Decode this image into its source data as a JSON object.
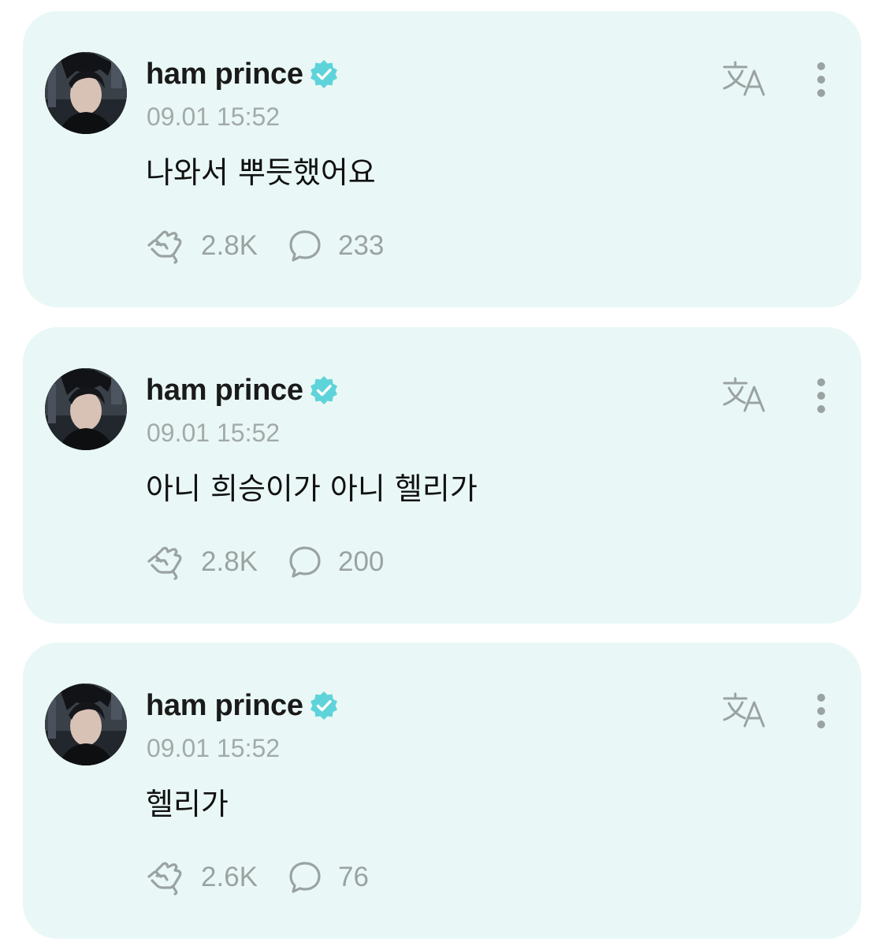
{
  "posts": [
    {
      "author": "ham prince",
      "time": "09.01 15:52",
      "text": "나와서 뿌듯했어요",
      "likes": "2.8K",
      "comments": "233"
    },
    {
      "author": "ham prince",
      "time": "09.01 15:52",
      "text": "아니 희승이가 아니 헬리가",
      "likes": "2.8K",
      "comments": "200"
    },
    {
      "author": "ham prince",
      "time": "09.01 15:52",
      "text": "헬리가",
      "likes": "2.6K",
      "comments": "76"
    }
  ],
  "icons": {
    "verified": "verified-badge-icon",
    "translate": "translate-icon",
    "more": "more-vertical-icon",
    "like": "like-hands-icon",
    "comment": "comment-bubble-icon"
  },
  "colors": {
    "card_background": "#e9f8f6",
    "verified_badge": "#5fd3da",
    "icon_gray": "#9aa3a2",
    "timestamp_gray": "#a3aaa9"
  }
}
